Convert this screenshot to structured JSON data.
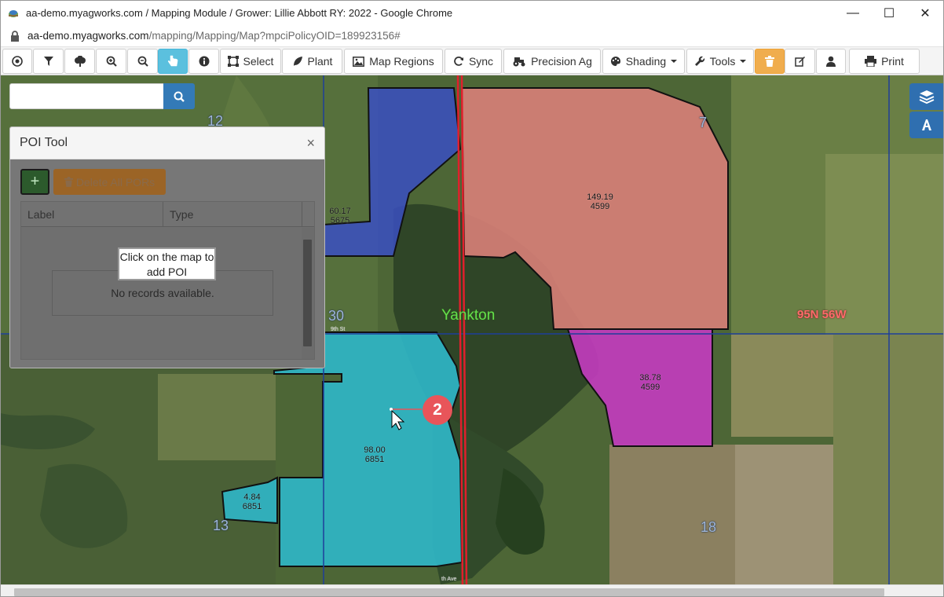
{
  "window": {
    "title": "aa-demo.myagworks.com / Mapping Module / Grower: Lillie Abbott RY: 2022 - Google Chrome",
    "url_host": "aa-demo.myagworks.com",
    "url_path": "/mapping/Mapping/Map?mpciPolicyOID=189923156#",
    "controls": {
      "minimize": "—",
      "maximize": "☐",
      "close": "✕"
    }
  },
  "toolbar": {
    "select_label": "Select",
    "plant_label": "Plant",
    "map_regions_label": "Map Regions",
    "sync_label": "Sync",
    "precision_ag_label": "Precision Ag",
    "shading_label": "Shading",
    "tools_label": "Tools",
    "print_label": "Print"
  },
  "search": {
    "placeholder": ""
  },
  "poi_tool": {
    "title": "POI Tool",
    "close": "×",
    "add_label": "+",
    "delete_label": "Delete All PORs",
    "columns": [
      "Label",
      "Type"
    ],
    "empty_text": "No records available.",
    "tip_text": "Click on the map to add POI"
  },
  "map": {
    "section_labels": [
      "12",
      "7",
      "30",
      "13",
      "18"
    ],
    "town": "Yankton",
    "township": "95N 56W",
    "fields": [
      {
        "acres": "60.17",
        "code": "5675"
      },
      {
        "acres": "149.19",
        "code": "4599"
      },
      {
        "acres": "38.78",
        "code": "4599"
      },
      {
        "acres": "98.00",
        "code": "6851"
      },
      {
        "acres": "4.84",
        "code": "6851"
      }
    ],
    "street_labels": [
      "9th St",
      "th Ave"
    ],
    "badge": "2",
    "colors": {
      "field_blue": "#3a4fc2",
      "field_salmon": "#d98079",
      "field_magenta": "#c43bc0",
      "field_teal": "#2fb5c6",
      "road": "#e0202c",
      "grid_line": "#1f3f9a"
    }
  }
}
